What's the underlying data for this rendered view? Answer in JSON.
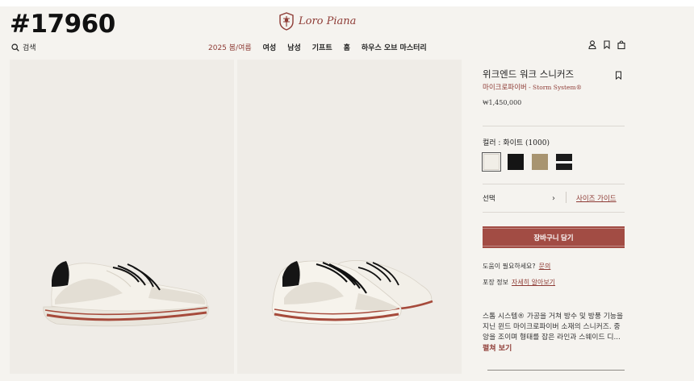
{
  "watermark": "#17960",
  "brand": {
    "name": "Loro Piana",
    "accent": "#8e3b35"
  },
  "header": {
    "search_label": "검색",
    "nav": [
      "2025 봄/여름",
      "여성",
      "남성",
      "기프트",
      "홈",
      "하우스 오브 마스터리"
    ],
    "icons": [
      "user-icon",
      "bookmark-icon",
      "shopping-bag-icon"
    ]
  },
  "product": {
    "title": "위크엔드 워크 스니커즈",
    "subtitle_main": "마이크로파이버",
    "subtitle_system": " - Storm System®",
    "price": "₩1,450,000",
    "color_label": "컬러 : ",
    "color_name": "화이트",
    "color_code": " (1000)",
    "swatches": [
      {
        "name": "white",
        "color": "#f1eee7",
        "selected": true
      },
      {
        "name": "black",
        "color": "#151515",
        "selected": false
      },
      {
        "name": "khaki",
        "color": "#a89470",
        "selected": false
      },
      {
        "name": "black-white",
        "color": "#1b1b1b",
        "selected": false
      }
    ],
    "select_label": "선택",
    "size_guide": "사이즈 가이드",
    "cart_button": "장바구니 담기",
    "help_text": "도움이 필요하세요?",
    "help_link": "문의",
    "pack_text": "포장 정보",
    "pack_link": "자세히 알아보기",
    "description": "스톰 시스템® 가공을 거쳐 방수 및 방풍 기능을 지닌 윈드 마이크로파이버 소재의 스니커즈. 중앙을 조이며 형태를 잡은 라인과 스웨이드 디...",
    "more": "펼쳐 보기"
  }
}
